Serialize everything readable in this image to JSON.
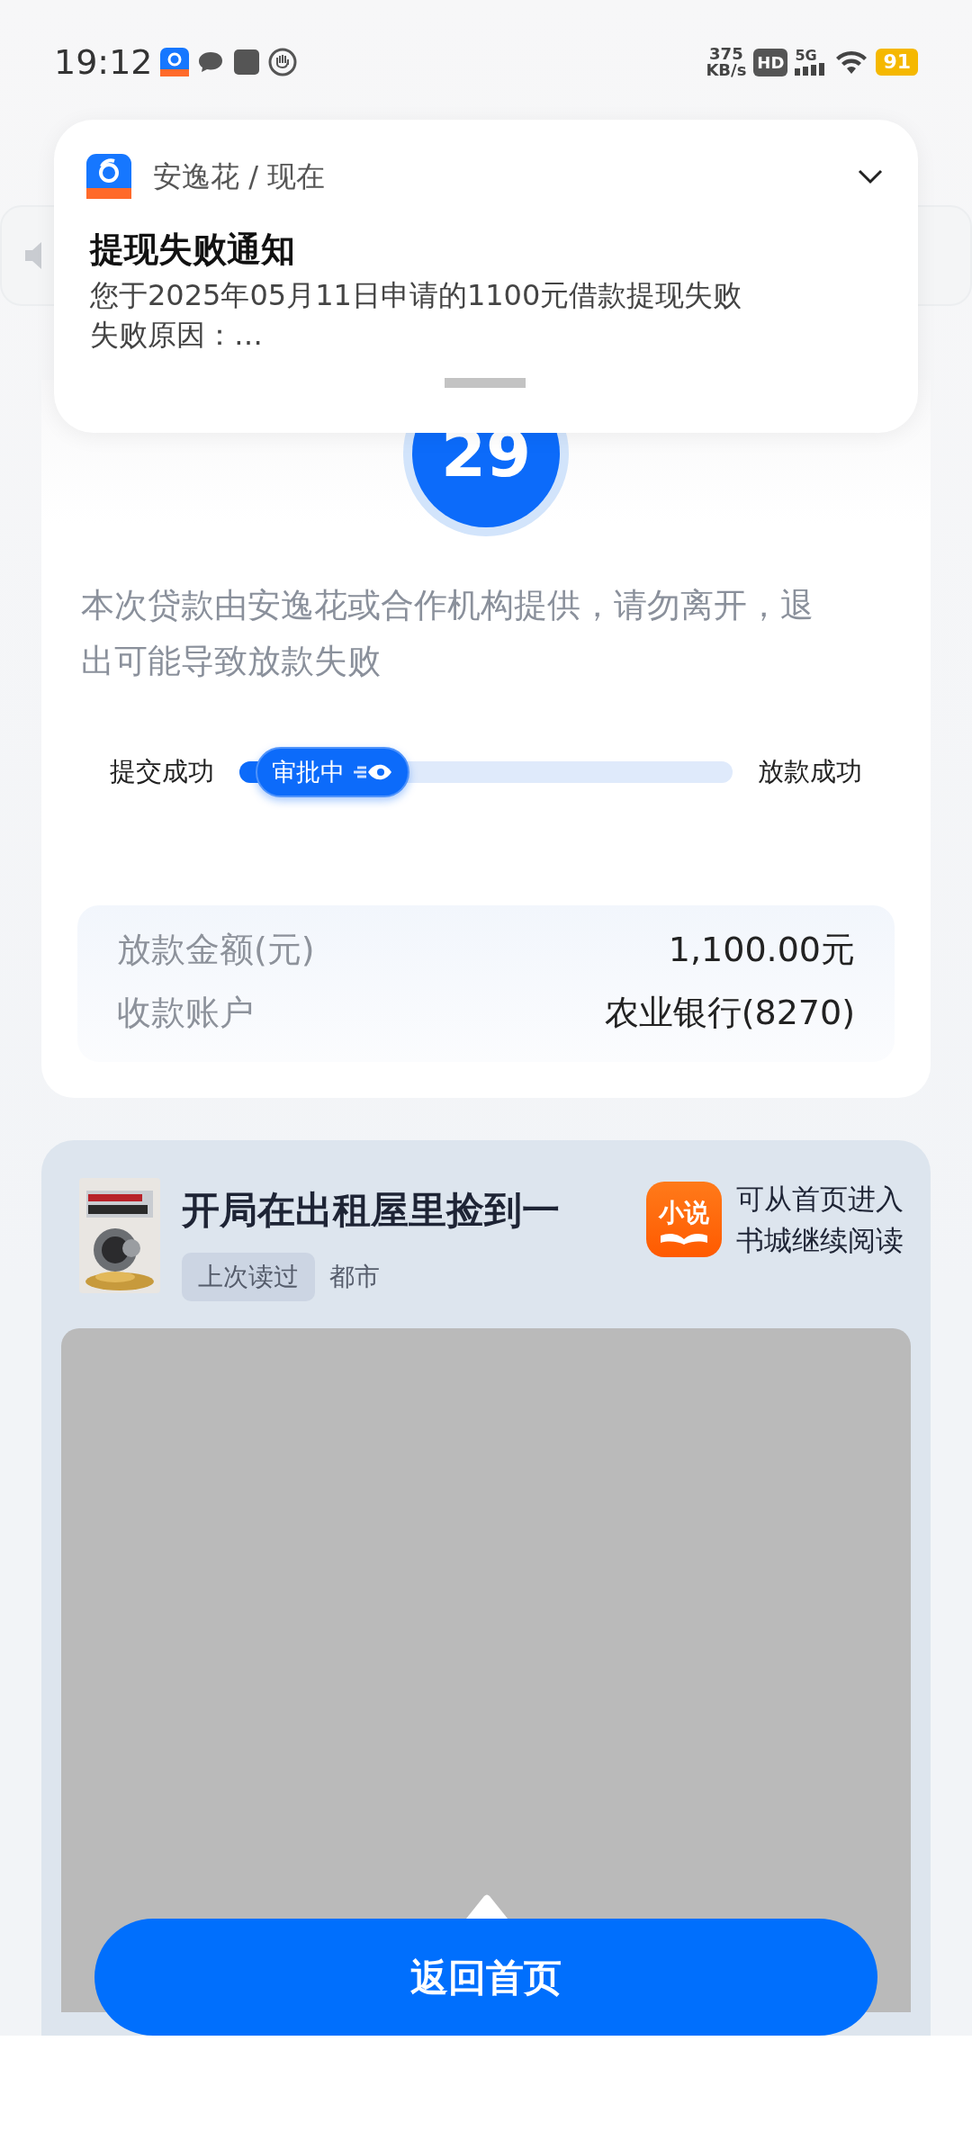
{
  "status_bar": {
    "time": "19:12",
    "net_speed": "375",
    "net_unit": "KB/s",
    "hd": "HD",
    "network": "5G",
    "battery": "91"
  },
  "notification": {
    "source": "安逸花 / 现在",
    "title": "提现失败通知",
    "lines": [
      "您于2025年05月11日申请的1100元借款提现失败",
      "失败原因：…"
    ]
  },
  "countdown": "29",
  "notice": "本次贷款由安逸花或合作机构提供，请勿离开，退出可能导致放款失败",
  "progress": {
    "start_label": "提交成功",
    "current_label": "审批中",
    "end_label": "放款成功",
    "level": 0.33
  },
  "details": [
    {
      "label": "放款金额(元)",
      "value": "1,100.00元"
    },
    {
      "label": "收款账户",
      "value": "农业银行(8270)"
    }
  ],
  "promo": {
    "book_title": "开局在出租屋里捡到一",
    "tag": "上次读过",
    "genre": "都市",
    "app_badge": "小说",
    "hint_lines": [
      "可从首页进入",
      "书城继续阅读"
    ]
  },
  "button": "返回首页"
}
